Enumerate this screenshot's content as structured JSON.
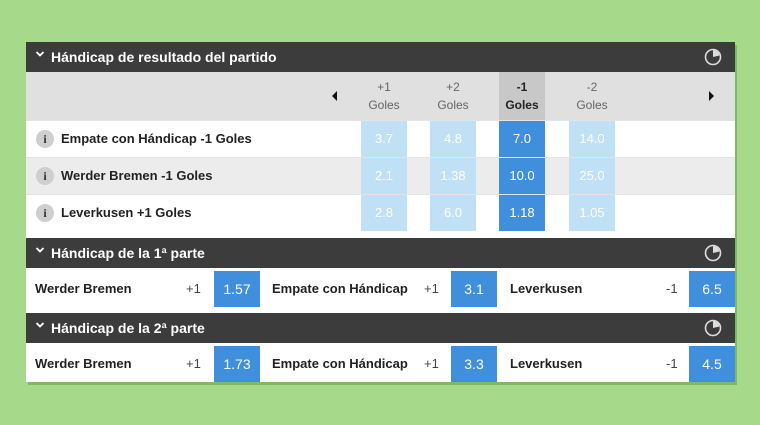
{
  "colors": {
    "header_bg": "#3c3c3c",
    "selected_odd": "#3f8fdc",
    "light_odd": "#c0e0f5",
    "page_bg": "#a6d98a"
  },
  "section1": {
    "title": "Hándicap de resultado del partido",
    "icons": [
      "chevron-down-icon",
      "clock-icon",
      "arrow-left-icon",
      "arrow-right-icon",
      "info-icon"
    ],
    "columns": [
      {
        "line": "+1",
        "unit": "Goles"
      },
      {
        "line": "+2",
        "unit": "Goles"
      },
      {
        "line": "-1",
        "unit": "Goles",
        "selected": true
      },
      {
        "line": "-2",
        "unit": "Goles"
      }
    ],
    "rows": [
      {
        "label": "Empate con Hándicap -1 Goles",
        "odds": [
          "3.7",
          "4.8",
          "7.0",
          "14.0"
        ]
      },
      {
        "label": "Werder Bremen -1 Goles",
        "odds": [
          "2.1",
          "1.38",
          "10.0",
          "25.0"
        ]
      },
      {
        "label": "Leverkusen +1 Goles",
        "odds": [
          "2.8",
          "6.0",
          "1.18",
          "1.05"
        ]
      }
    ],
    "info_glyph": "i"
  },
  "section2": {
    "title": "Hándicap de la 1ª parte",
    "outcomes": [
      {
        "name": "Werder Bremen",
        "line": "+1",
        "odd": "1.57"
      },
      {
        "name": "Empate con Hándicap",
        "line": "+1",
        "odd": "3.1"
      },
      {
        "name": "Leverkusen",
        "line": "-1",
        "odd": "6.5"
      }
    ]
  },
  "section3": {
    "title": "Hándicap de la 2ª parte",
    "outcomes": [
      {
        "name": "Werder Bremen",
        "line": "+1",
        "odd": "1.73"
      },
      {
        "name": "Empate con Hándicap",
        "line": "+1",
        "odd": "3.3"
      },
      {
        "name": "Leverkusen",
        "line": "-1",
        "odd": "4.5"
      }
    ]
  }
}
